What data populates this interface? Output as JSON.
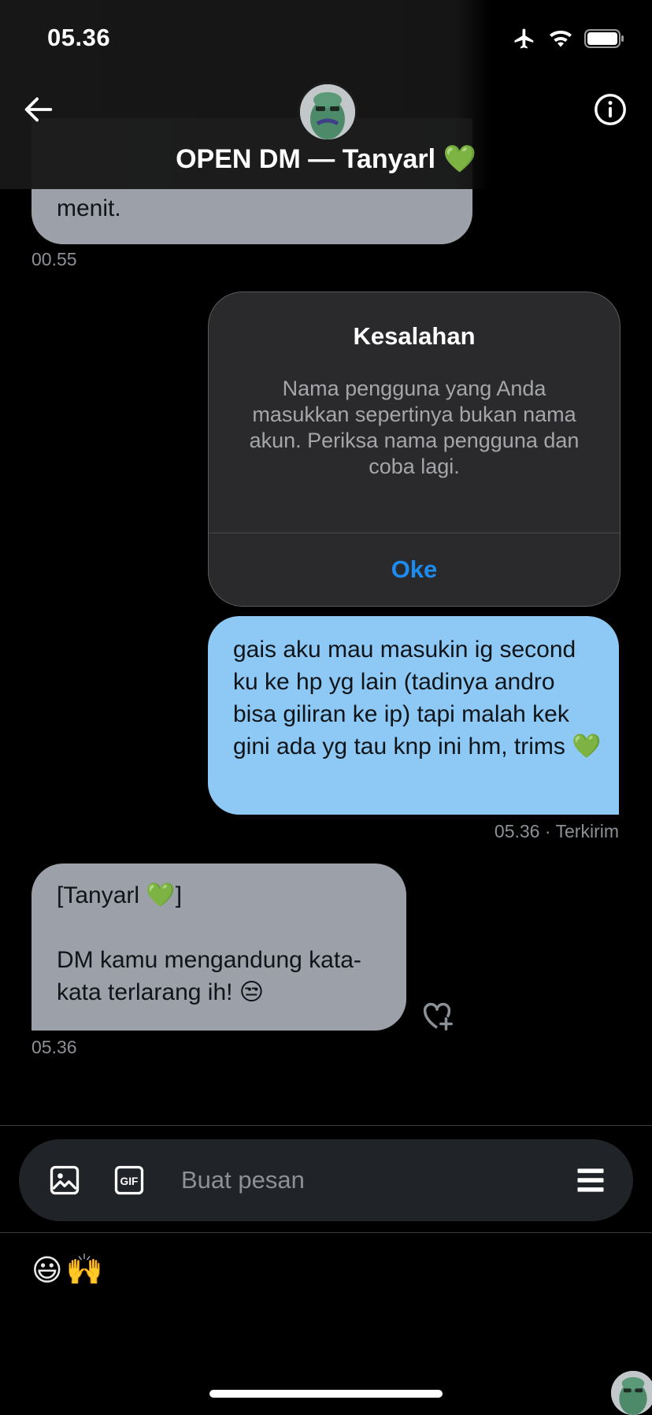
{
  "status": {
    "time": "05.36"
  },
  "header": {
    "title": "OPEN DM — Tanyarl 💚"
  },
  "messages": {
    "partial": {
      "text": "menit.",
      "time": "00.55"
    },
    "alert": {
      "title": "Kesalahan",
      "message": "Nama pengguna yang Anda masukkan sepertinya bukan nama akun. Periksa nama pengguna dan coba lagi.",
      "button": "Oke"
    },
    "outgoing": {
      "text": "gais aku mau masukin ig second ku ke hp yg lain (tadinya andro bisa giliran ke ip) tapi malah kek gini ada yg tau knp ini hm, trims 💚",
      "time": "05.36",
      "status": "· Terkirim"
    },
    "incoming": {
      "line1": "[Tanyarl 💚]",
      "line2": "DM kamu mengandung kata-kata terlarang ih! 😒",
      "time": "05.36"
    }
  },
  "composer": {
    "placeholder": "Buat pesan"
  },
  "emojis": [
    "😃",
    "🙌"
  ],
  "colors": {
    "accent": "#1d8cf0",
    "outgoing_bubble": "#8ec9f5",
    "incoming_bubble": "#9ca0a8",
    "composer_bg": "#202327"
  },
  "icons": {
    "back": "arrow-left-icon",
    "info": "info-icon",
    "image": "image-icon",
    "gif": "gif-icon",
    "menu": "menu-icon",
    "like": "heart-plus-icon"
  }
}
